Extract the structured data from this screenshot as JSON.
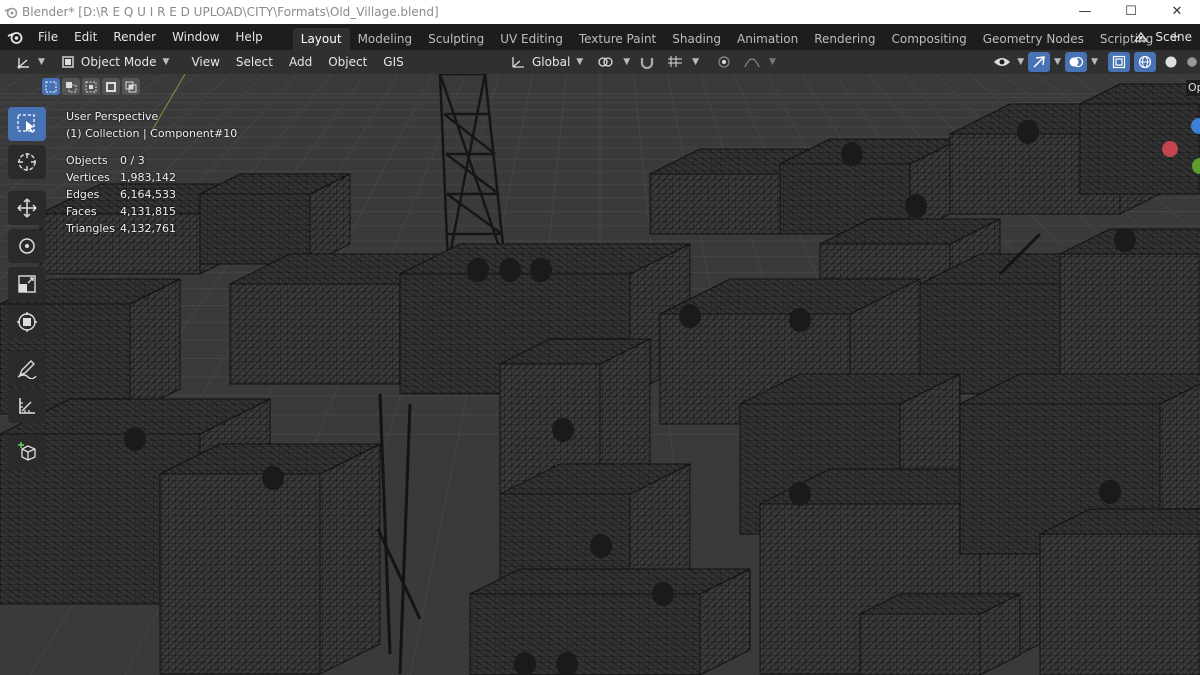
{
  "window": {
    "title": "Blender* [D:\\R E Q U I R E D    UPLOAD\\CITY\\Formats\\Old_Village.blend]",
    "minimize": "—",
    "maximize": "☐",
    "close": "✕"
  },
  "menus": [
    "File",
    "Edit",
    "Render",
    "Window",
    "Help"
  ],
  "workspaces": [
    "Layout",
    "Modeling",
    "Sculpting",
    "UV Editing",
    "Texture Paint",
    "Shading",
    "Animation",
    "Rendering",
    "Compositing",
    "Geometry Nodes",
    "Scripting"
  ],
  "workspace_plus": "+",
  "scene": {
    "label": "Scene"
  },
  "viewport_header": {
    "mode": "Object Mode",
    "menus": [
      "View",
      "Select",
      "Add",
      "Object",
      "GIS"
    ],
    "orientation": "Global"
  },
  "overlay": {
    "perspective": "User Perspective",
    "collection": "(1) Collection | Component#10",
    "stats": [
      {
        "key": "Objects",
        "value": "0 / 3"
      },
      {
        "key": "Vertices",
        "value": "1,983,142"
      },
      {
        "key": "Edges",
        "value": "6,164,533"
      },
      {
        "key": "Faces",
        "value": "4,131,815"
      },
      {
        "key": "Triangles",
        "value": "4,132,761"
      }
    ]
  },
  "right_clip": "Op",
  "colors": {
    "accent": "#4772b3",
    "bg": "#303030",
    "header": "#1d1d1d"
  }
}
